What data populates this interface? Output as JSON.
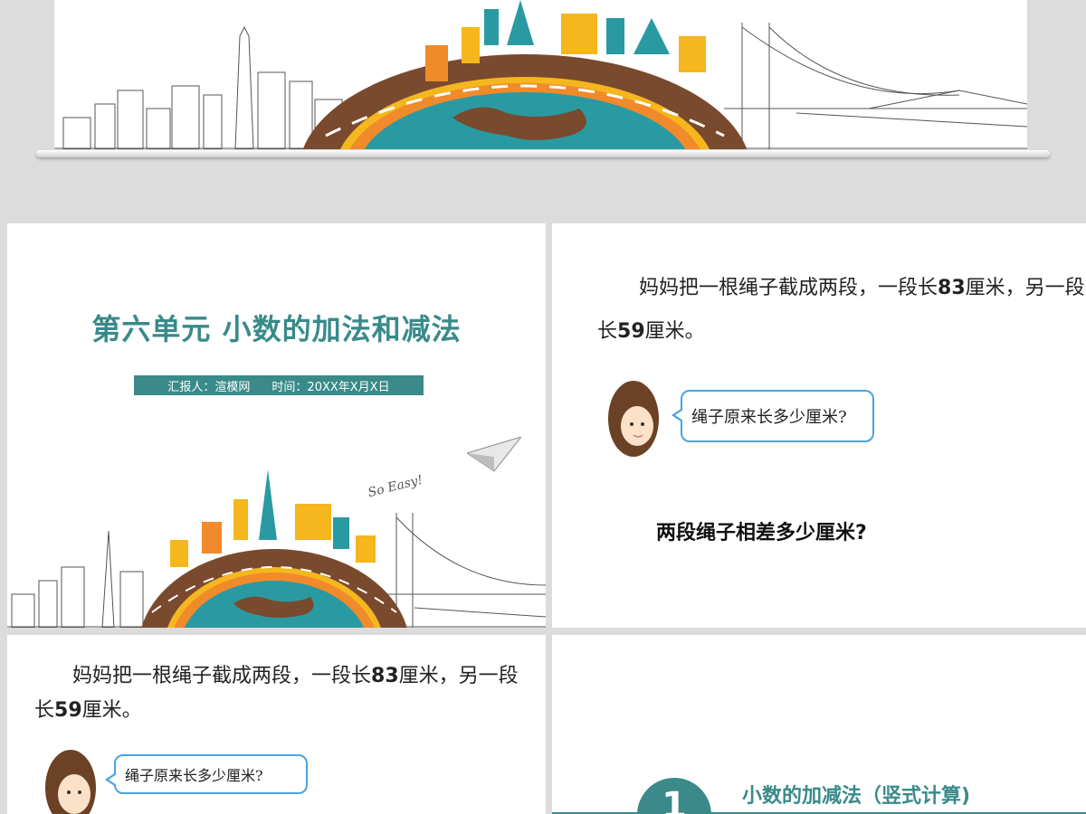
{
  "slides": {
    "title_slide": {
      "title": "第六单元 小数的加法和减法",
      "reporter": "汇报人：渲模网",
      "time": "时间：20XX年X月X日",
      "tagline": "So Easy!"
    },
    "problem_slide": {
      "line1_a": "妈妈把一根绳子截成两段，一段长",
      "num1": "83",
      "line1_b": "厘米，另一段",
      "line2_a": "长",
      "num2": "59",
      "line2_b": "厘米。",
      "bubble": "绳子原来长多少厘米?",
      "question": "两段绳子相差多少厘米?"
    },
    "section_slide": {
      "number": "1",
      "title": "小数的加减法（竖式计算)"
    }
  },
  "colors": {
    "accent": "#3a8a8a",
    "bubble_border": "#4aa3df",
    "road": "#7a4a2e",
    "globe": "#2a9aa2",
    "orange": "#f08a2a",
    "yellow": "#f5b61e"
  }
}
